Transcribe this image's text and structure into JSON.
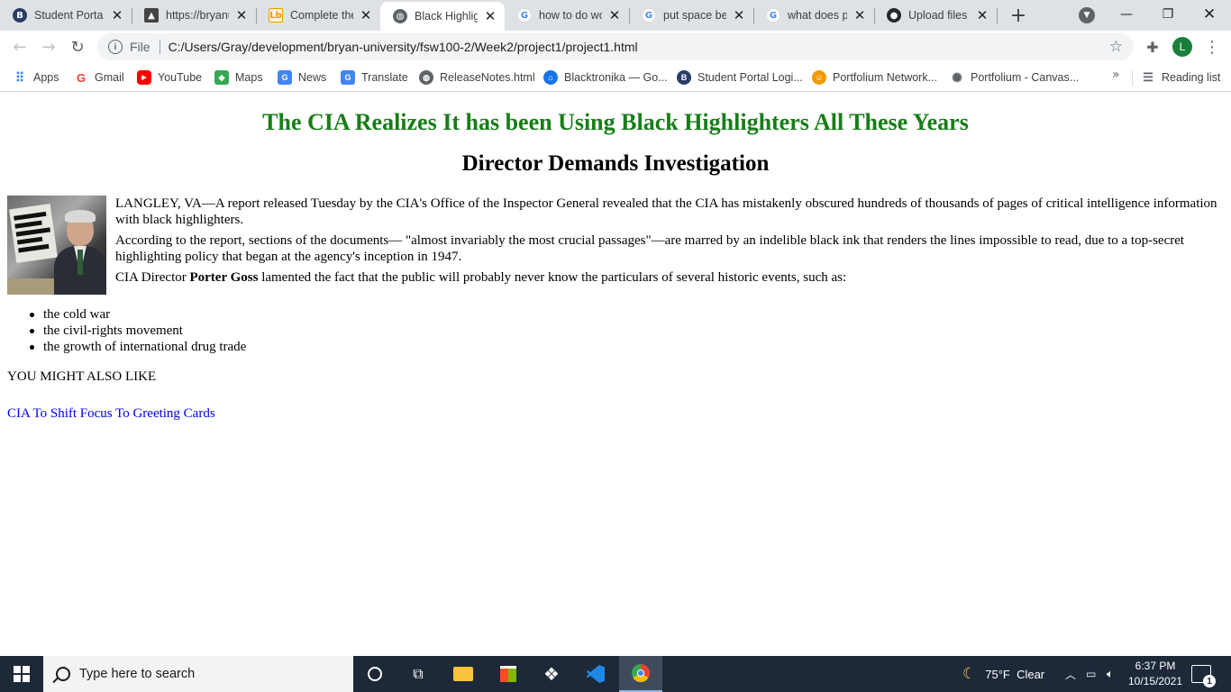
{
  "browser": {
    "tabs": [
      {
        "title": "Student Porta",
        "icon": "bryan-university-icon",
        "color": "#2a3d66"
      },
      {
        "title": "https://bryanu",
        "icon": "mountain-favicon-icon",
        "color": "#444444"
      },
      {
        "title": "Complete the",
        "icon": "lb-favicon-icon",
        "color": "#f29900"
      },
      {
        "title": "Black Highligh",
        "icon": "globe-icon",
        "color": "#5f6368"
      },
      {
        "title": "how to do wo",
        "icon": "google-icon",
        "color": "#ffffff"
      },
      {
        "title": "put space bet",
        "icon": "google-icon",
        "color": "#ffffff"
      },
      {
        "title": "what does pa",
        "icon": "google-icon",
        "color": "#ffffff"
      },
      {
        "title": "Upload files",
        "icon": "github-icon",
        "color": "#24292f"
      }
    ],
    "active_tab": 3,
    "address": {
      "scheme": "File",
      "url": "C:/Users/Gray/development/bryan-university/fsw100-2/Week2/project1/project1.html"
    },
    "profile_initial": "L",
    "bookmarks": [
      {
        "label": "Apps",
        "icon": "apps-grid-icon"
      },
      {
        "label": "Gmail",
        "icon": "google-icon"
      },
      {
        "label": "YouTube",
        "icon": "youtube-icon"
      },
      {
        "label": "Maps",
        "icon": "maps-icon"
      },
      {
        "label": "News",
        "icon": "news-icon"
      },
      {
        "label": "Translate",
        "icon": "translate-icon"
      },
      {
        "label": "ReleaseNotes.html",
        "icon": "globe-icon"
      },
      {
        "label": "Blacktronika — Go...",
        "icon": "bank-icon"
      },
      {
        "label": "Student Portal Logi...",
        "icon": "bryan-university-icon"
      },
      {
        "label": "Portfolium Network...",
        "icon": "portfolium-icon"
      },
      {
        "label": "Portfolium - Canvas...",
        "icon": "canvas-icon"
      }
    ],
    "more_bookmarks": "»",
    "reading_list": "Reading list"
  },
  "page": {
    "headline": "The CIA Realizes It has been Using Black Highlighters All These Years",
    "subheadline": "Director Demands Investigation",
    "colors": {
      "headline": "#177e17",
      "link": "#0000ee"
    },
    "paragraph1": "LANGLEY, VA—A report released Tuesday by the CIA's Office of the Inspector General revealed that the CIA has mistakenly obscured hundreds of thousands of pages of critical intelligence information with black highlighters.",
    "paragraph2": "According to the report, sections of the documents— \"almost invariably the most crucial passages\"—are marred by an indelible black ink that renders the lines impossible to read, due to a top-secret highlighting policy that began at the agency's inception in 1947.",
    "paragraph3_pre": "CIA Director ",
    "paragraph3_bold": "Porter Goss",
    "paragraph3_post": " lamented the fact that the public will probably never know the particulars of several historic events, such as:",
    "events": [
      "the cold war",
      "the civil-rights movement",
      "the growth of international drug trade"
    ],
    "also_like": "YOU MIGHT ALSO LIKE",
    "related_link": "CIA To Shift Focus To Greeting Cards"
  },
  "taskbar": {
    "search_placeholder": "Type here to search",
    "weather": "75°F  Clear",
    "time": "6:37 PM",
    "date": "10/15/2021",
    "notification_count": "1"
  }
}
